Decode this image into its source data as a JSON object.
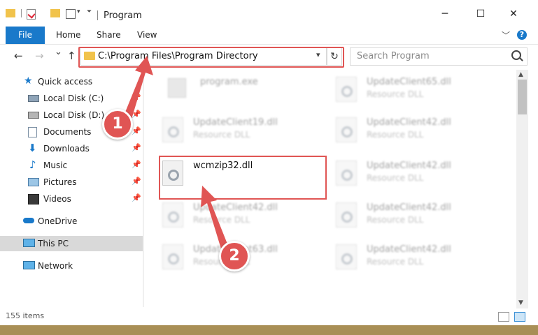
{
  "window": {
    "title": "Program",
    "minimize": "─",
    "maximize": "☐",
    "close": "✕"
  },
  "ribbon": {
    "file_tab": "File",
    "tabs": [
      "Home",
      "Share",
      "View"
    ],
    "expand_icon": "﹀",
    "help_icon": "?"
  },
  "nav": {
    "back": "←",
    "forward": "→",
    "recent": "⌄",
    "up": "↑",
    "address": "C:\\Program Files\\Program Directory",
    "refresh": "↻",
    "search_placeholder": "Search Program"
  },
  "sidebar": {
    "items": [
      {
        "label": "Quick access",
        "icon": "star-icon"
      },
      {
        "label": "Local Disk (C:)",
        "icon": "drive-icon",
        "pinned": true
      },
      {
        "label": "Local Disk (D:)",
        "icon": "drive-icon",
        "pinned": true
      },
      {
        "label": "Documents",
        "icon": "documents-icon",
        "pinned": true
      },
      {
        "label": "Downloads",
        "icon": "downloads-icon",
        "pinned": true
      },
      {
        "label": "Music",
        "icon": "music-icon",
        "pinned": true
      },
      {
        "label": "Pictures",
        "icon": "pictures-icon",
        "pinned": true
      },
      {
        "label": "Videos",
        "icon": "videos-icon",
        "pinned": true
      },
      {
        "label": "OneDrive",
        "icon": "cloud-icon"
      },
      {
        "label": "This PC",
        "icon": "computer-icon",
        "selected": true
      },
      {
        "label": "Network",
        "icon": "network-icon"
      }
    ]
  },
  "files": [
    {
      "name": "program.exe",
      "type": ""
    },
    {
      "name": "UpdateClient65.dll",
      "type": "Resource DLL"
    },
    {
      "name": "UpdateClient19.dll",
      "type": "Resource DLL"
    },
    {
      "name": "UpdateClient42.dll",
      "type": "Resource DLL"
    },
    {
      "name": "wcmzip32.dll",
      "type": ""
    },
    {
      "name": "UpdateClient42.dll",
      "type": "Resource DLL"
    },
    {
      "name": "UpdateClient42.dll",
      "type": "Resource DLL"
    },
    {
      "name": "UpdateClient42.dll",
      "type": "Resource DLL"
    },
    {
      "name": "UpdateClient63.dll",
      "type": "Resource DLL"
    },
    {
      "name": "UpdateClient42.dll",
      "type": "Resource DLL"
    }
  ],
  "status": {
    "item_count": "155 items"
  },
  "callouts": [
    "1",
    "2"
  ],
  "colors": {
    "accent": "#1979ca",
    "highlight": "#e05554",
    "folder": "#f1c34c"
  }
}
